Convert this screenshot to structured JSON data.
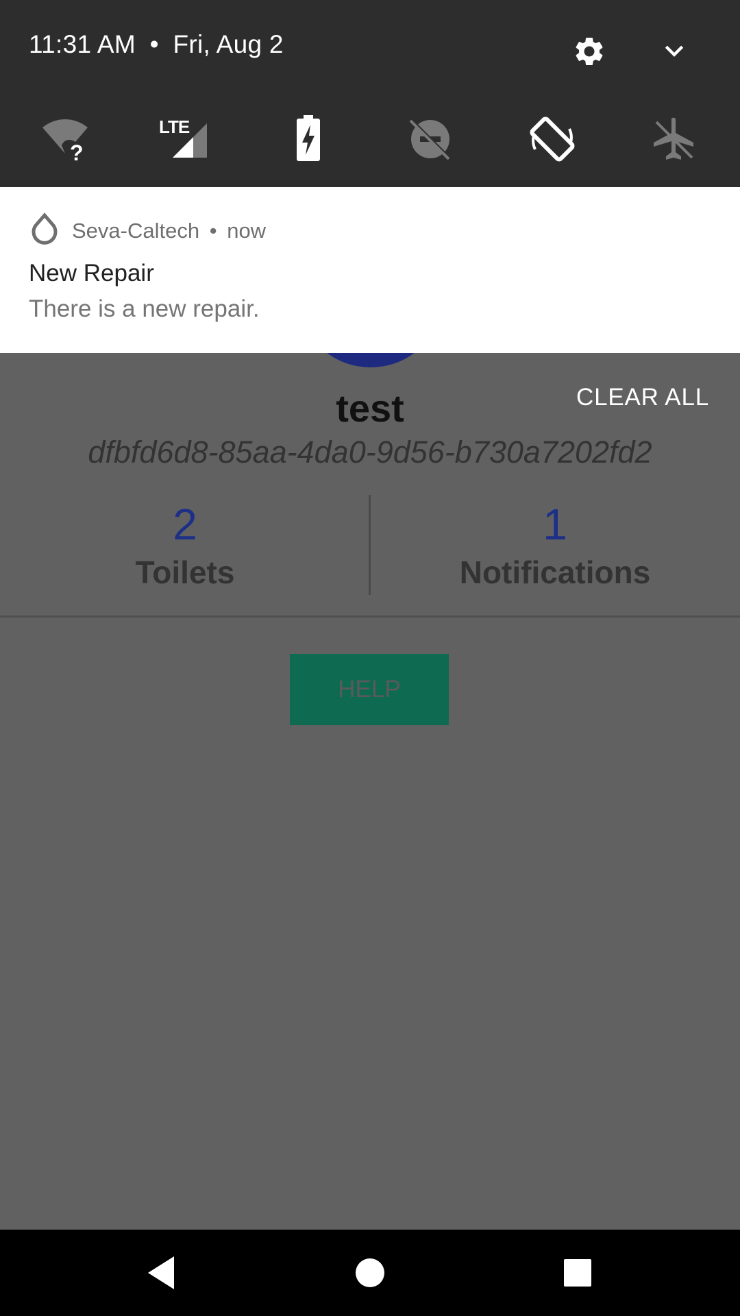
{
  "status_shade": {
    "time": "11:31 AM",
    "separator": "•",
    "date": "Fri, Aug 2",
    "tiles": [
      {
        "icon": "wifi-unknown-icon",
        "state": "off"
      },
      {
        "icon": "lte-signal-icon",
        "label": "LTE",
        "state": "on"
      },
      {
        "icon": "battery-charging-icon",
        "state": "on"
      },
      {
        "icon": "do-not-disturb-off-icon",
        "state": "off"
      },
      {
        "icon": "auto-rotate-icon",
        "state": "on"
      },
      {
        "icon": "airplane-mode-icon",
        "state": "off"
      }
    ]
  },
  "notification": {
    "app_name": "Seva-Caltech",
    "separator": "•",
    "time": "now",
    "title": "New Repair",
    "text": "There is a new repair."
  },
  "shade_actions": {
    "clear_all_label": "CLEAR ALL"
  },
  "profile": {
    "name": "test",
    "id": "dfbfd6d8-85aa-4da0-9d56-b730a7202fd2",
    "stats": [
      {
        "value": "2",
        "label": "Toilets"
      },
      {
        "value": "1",
        "label": "Notifications"
      }
    ],
    "help_label": "HELP"
  },
  "colors": {
    "shade_bg": "#2d2d2d",
    "scrim": "#616161",
    "accent_blue": "#1d2f87",
    "help_green": "#0f6a52"
  }
}
